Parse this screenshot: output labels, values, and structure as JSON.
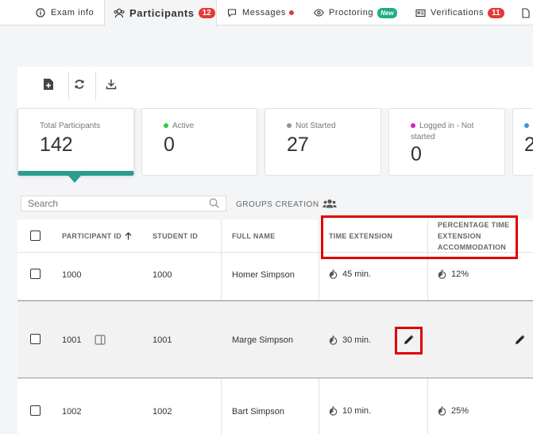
{
  "tabs": [
    {
      "label": "Exam info",
      "icon": "info-icon"
    },
    {
      "label": "Participants",
      "icon": "participants-icon",
      "badge": "12"
    },
    {
      "label": "Messages",
      "icon": "message-icon"
    },
    {
      "label": "Proctoring",
      "icon": "eye-icon",
      "badge": "New"
    },
    {
      "label": "Verifications",
      "icon": "id-card-icon",
      "badge": "11"
    }
  ],
  "toolbar": {
    "icons": [
      "add-file-icon",
      "refresh-icon",
      "download-icon"
    ]
  },
  "stats": [
    {
      "label": "Total Participants",
      "value": "142"
    },
    {
      "label": "Active",
      "value": "0",
      "color": "#2ecc40"
    },
    {
      "label": "Not Started",
      "value": "27",
      "color": "#8a94a6"
    },
    {
      "label_line1": "Logged in - Not",
      "label_line2": "started",
      "value": "0",
      "color": "#d61fbd"
    },
    {
      "label": "",
      "value": "",
      "color": "#3498db"
    }
  ],
  "search": {
    "placeholder": "Search"
  },
  "groups": {
    "label": "GROUPS CREATION"
  },
  "table": {
    "headers": {
      "participant_id": "PARTICIPANT ID",
      "student_id": "STUDENT ID",
      "full_name": "FULL NAME",
      "time_extension": "TIME EXTENSION",
      "pct_line1": "PERCENTAGE TIME",
      "pct_line2": "EXTENSION",
      "pct_line3": "ACCOMMODATION"
    },
    "rows": [
      {
        "participant_id": "1000",
        "student_id": "1000",
        "full_name": "Homer Simpson",
        "time_extension": "45 min.",
        "pct": "12%"
      },
      {
        "participant_id": "1001",
        "student_id": "1001",
        "full_name": "Marge Simpson",
        "time_extension": "30 min.",
        "pct": ""
      },
      {
        "participant_id": "1002",
        "student_id": "1002",
        "full_name": "Bart Simpson",
        "time_extension": "10 min.",
        "pct": "25%"
      }
    ]
  },
  "colors": {
    "accent": "#2a9d8f",
    "highlight": "#e00000",
    "badge": "#e53935",
    "new_badge": "#1fae85"
  }
}
